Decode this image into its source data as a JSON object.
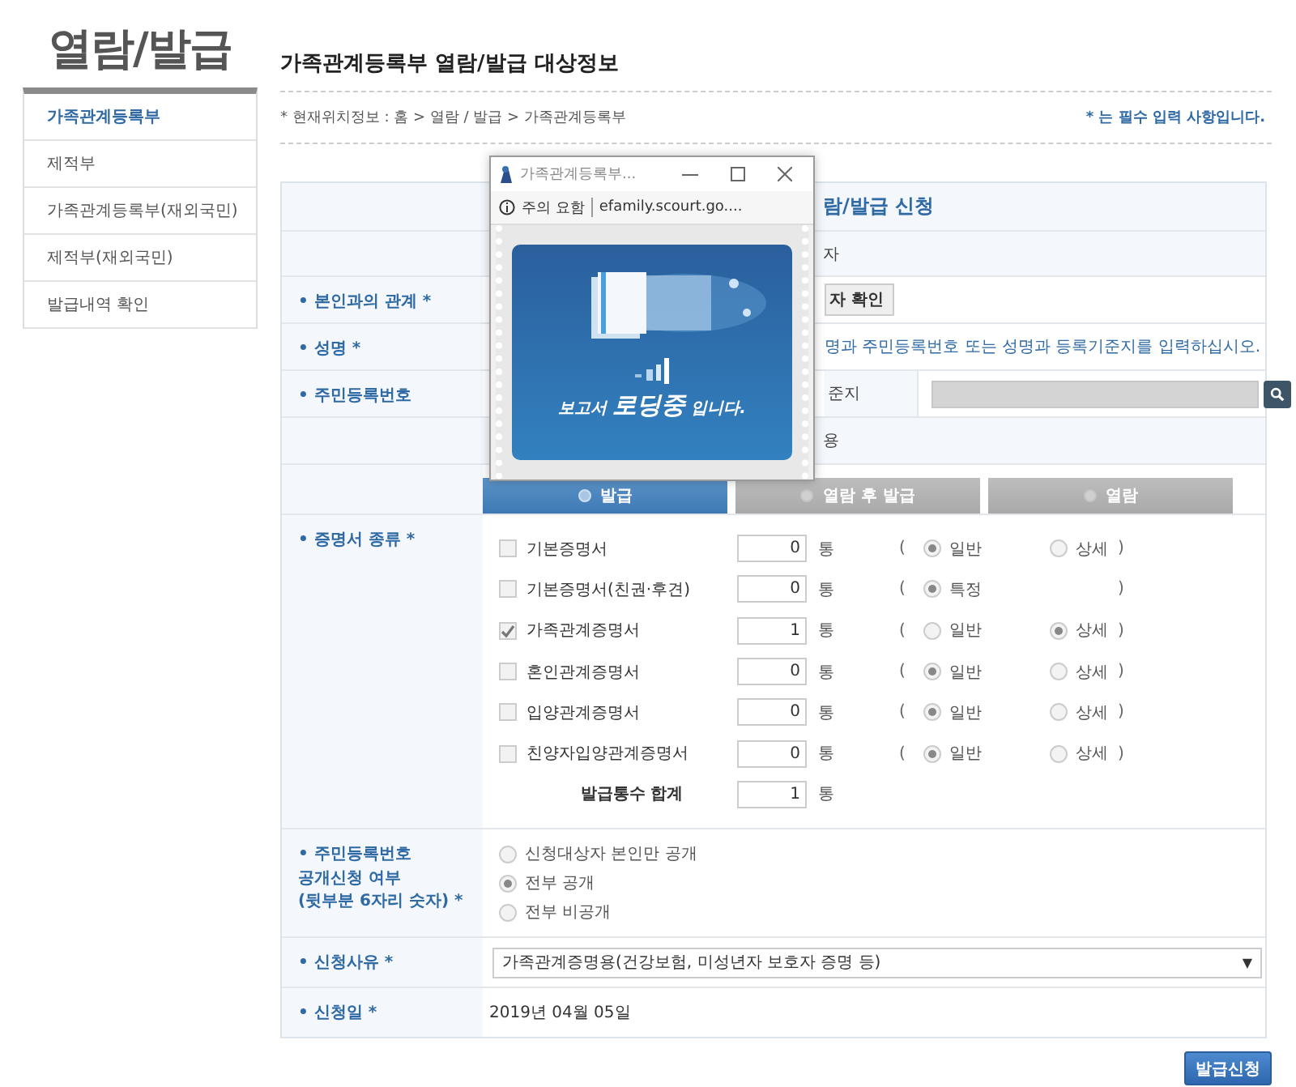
{
  "page_title": "열람/발급",
  "sidebar": {
    "items": [
      {
        "label": "가족관계등록부",
        "selected": true
      },
      {
        "label": "제적부",
        "selected": false
      },
      {
        "label": "가족관계등록부(재외국민)",
        "selected": false
      },
      {
        "label": "제적부(재외국민)",
        "selected": false
      },
      {
        "label": "발급내역 확인",
        "selected": false
      }
    ]
  },
  "header": {
    "title": "가족관계등록부 열람/발급 대상정보",
    "breadcrumb": "* 현재위치정보 : 홈 > 열람 / 발급 > 가족관계등록부",
    "required_note": "* 는 필수 입력 사항입니다."
  },
  "form": {
    "title": "람/발급 신청",
    "target_heading": "자",
    "relation": {
      "label": "• 본인과의 관계 *",
      "button": "자 확인"
    },
    "name": {
      "label": "• 성명 *",
      "hint": "명과 주민등록번호 또는 성명과 등록기준지를 입력하십시오."
    },
    "resident_id": {
      "label": "• 주민등록번호",
      "sub_label": "준지"
    },
    "content_heading": "용",
    "modes": [
      {
        "label": "발급",
        "selected": true
      },
      {
        "label": "열람 후 발급",
        "selected": false
      },
      {
        "label": "열람",
        "selected": false
      }
    ],
    "certificates": {
      "label": "• 증명서 종류 *",
      "items": [
        {
          "name": "기본증명서",
          "checked": false,
          "count": "0",
          "unit": "통",
          "open": "(",
          "close": ")",
          "options": [
            {
              "label": "일반",
              "selected": true
            },
            {
              "label": "상세",
              "selected": false
            }
          ]
        },
        {
          "name": "기본증명서(친권·후견)",
          "checked": false,
          "count": "0",
          "unit": "통",
          "open": "(",
          "close": ")",
          "options": [
            {
              "label": "특정",
              "selected": true
            }
          ]
        },
        {
          "name": "가족관계증명서",
          "checked": true,
          "count": "1",
          "unit": "통",
          "open": "(",
          "close": ")",
          "options": [
            {
              "label": "일반",
              "selected": false
            },
            {
              "label": "상세",
              "selected": true
            }
          ]
        },
        {
          "name": "혼인관계증명서",
          "checked": false,
          "count": "0",
          "unit": "통",
          "open": "(",
          "close": ")",
          "options": [
            {
              "label": "일반",
              "selected": true
            },
            {
              "label": "상세",
              "selected": false
            }
          ]
        },
        {
          "name": "입양관계증명서",
          "checked": false,
          "count": "0",
          "unit": "통",
          "open": "(",
          "close": ")",
          "options": [
            {
              "label": "일반",
              "selected": true
            },
            {
              "label": "상세",
              "selected": false
            }
          ]
        },
        {
          "name": "친양자입양관계증명서",
          "checked": false,
          "count": "0",
          "unit": "통",
          "open": "(",
          "close": ")",
          "options": [
            {
              "label": "일반",
              "selected": true
            },
            {
              "label": "상세",
              "selected": false
            }
          ]
        }
      ],
      "total": {
        "label": "발급통수 합계",
        "count": "1",
        "unit": "통"
      }
    },
    "disclosure": {
      "label": "• 주민등록번호\n공개신청 여부\n(뒷부분 6자리 숫자) *",
      "options": [
        {
          "label": "신청대상자 본인만 공개",
          "selected": false
        },
        {
          "label": "전부 공개",
          "selected": true
        },
        {
          "label": "전부 비공개",
          "selected": false
        }
      ]
    },
    "reason": {
      "label": "• 신청사유 *",
      "value": "가족관계증명용(건강보험, 미성년자 보호자 증명 등)",
      "arrow": "▼"
    },
    "date": {
      "label": "• 신청일 *",
      "value": "2019년 04월 05일"
    },
    "submit": "발급신청"
  },
  "popup": {
    "title": "가족관계등록부...",
    "security": "주의 요함",
    "url": "efamily.scourt.go....",
    "message": "보고서 **로딩중** 입니다."
  }
}
